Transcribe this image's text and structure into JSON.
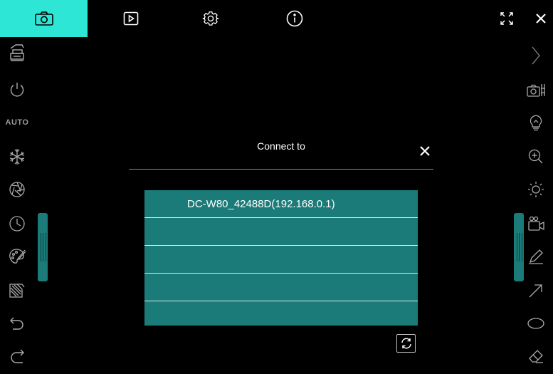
{
  "topbar": {
    "tabs": [
      {
        "icon": "camera-icon",
        "active": true
      },
      {
        "icon": "playback-icon",
        "active": false
      },
      {
        "icon": "settings-gear-icon",
        "active": false
      },
      {
        "icon": "info-icon",
        "active": false
      }
    ],
    "right_buttons": [
      {
        "icon": "fullscreen-icon"
      },
      {
        "icon": "close-icon"
      }
    ],
    "accent_color": "#2ee6d6"
  },
  "left_toolbar": {
    "items": [
      {
        "icon": "document-camera-icon"
      },
      {
        "icon": "power-icon"
      },
      {
        "text": "AUTO"
      },
      {
        "icon": "freeze-snowflake-icon"
      },
      {
        "icon": "aperture-icon"
      },
      {
        "icon": "timer-clock-icon"
      },
      {
        "icon": "palette-icon"
      },
      {
        "icon": "mirror-icon"
      },
      {
        "icon": "undo-icon"
      },
      {
        "icon": "redo-icon"
      }
    ]
  },
  "right_toolbar": {
    "items": [
      {
        "icon": "chevron-right-icon"
      },
      {
        "icon": "camera-settings-icon"
      },
      {
        "icon": "lightbulb-icon"
      },
      {
        "icon": "zoom-in-icon"
      },
      {
        "icon": "brightness-icon"
      },
      {
        "icon": "video-record-icon"
      },
      {
        "icon": "pen-icon"
      },
      {
        "icon": "arrow-icon"
      },
      {
        "icon": "ellipse-icon"
      },
      {
        "icon": "eraser-icon"
      }
    ]
  },
  "dialog": {
    "title": "Connect to",
    "devices": [
      "DC-W80_42488D(192.168.0.1)",
      "",
      "",
      "",
      ""
    ],
    "list_color": "#1b7b78"
  }
}
